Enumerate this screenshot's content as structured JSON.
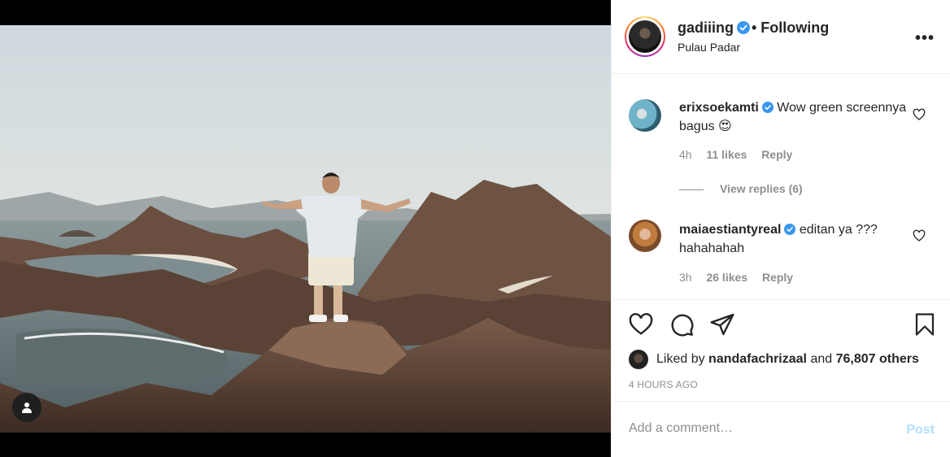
{
  "post": {
    "username": "gadiiing",
    "following_label": "• Following",
    "location": "Pulau Padar",
    "more_label": "•••"
  },
  "comments": [
    {
      "username": "erixsoekamti",
      "text": "Wow green screennya bagus 😍",
      "time": "4h",
      "likes": "11 likes",
      "reply": "Reply"
    },
    {
      "username": "maiaestiantyreal",
      "text": "editan ya ??? hahahahah",
      "time": "3h",
      "likes": "26 likes",
      "reply": "Reply"
    }
  ],
  "view_replies": "View replies (6)",
  "likes": {
    "prefix": "Liked by",
    "user": "nandafachrizaal",
    "and": "and",
    "others": "76,807 others"
  },
  "timestamp": "4 HOURS AGO",
  "add_comment": {
    "placeholder": "Add a comment…",
    "post_label": "Post"
  },
  "colors": {
    "verified": "#3897f0",
    "muted": "#8e8e8e",
    "post_disabled": "#b2dffc"
  }
}
